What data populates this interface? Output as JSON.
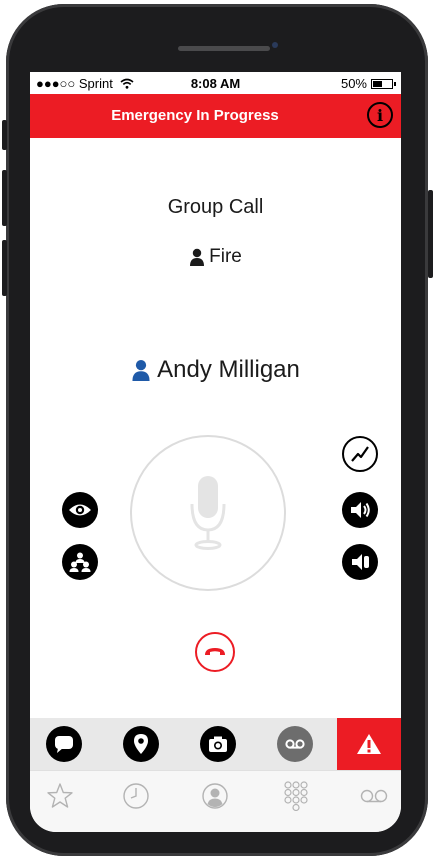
{
  "status_bar": {
    "carrier": "●●●○○ Sprint",
    "time": "8:08 AM",
    "battery": "50%",
    "battery_level": 0.5
  },
  "header": {
    "title": "Emergency In Progress",
    "info_label": "i"
  },
  "call": {
    "type": "Group Call",
    "group_name": "Fire",
    "caller_name": "Andy Milligan"
  },
  "colors": {
    "accent_red": "#ec1c24",
    "caller_blue": "#1f5aa8"
  },
  "icons": {
    "left_controls": [
      "eye-icon",
      "group-members-icon"
    ],
    "right_controls": [
      "signal-icon",
      "speaker-icon",
      "earpiece-icon"
    ],
    "center": "microphone-icon",
    "end_call": "hang-up-icon",
    "action_bar": [
      "message-icon",
      "location-icon",
      "camera-icon",
      "voicemail-icon",
      "emergency-alert-icon"
    ],
    "tab_bar": [
      "favorites-icon",
      "recents-icon",
      "contacts-icon",
      "keypad-icon",
      "voicemail-icon"
    ]
  }
}
